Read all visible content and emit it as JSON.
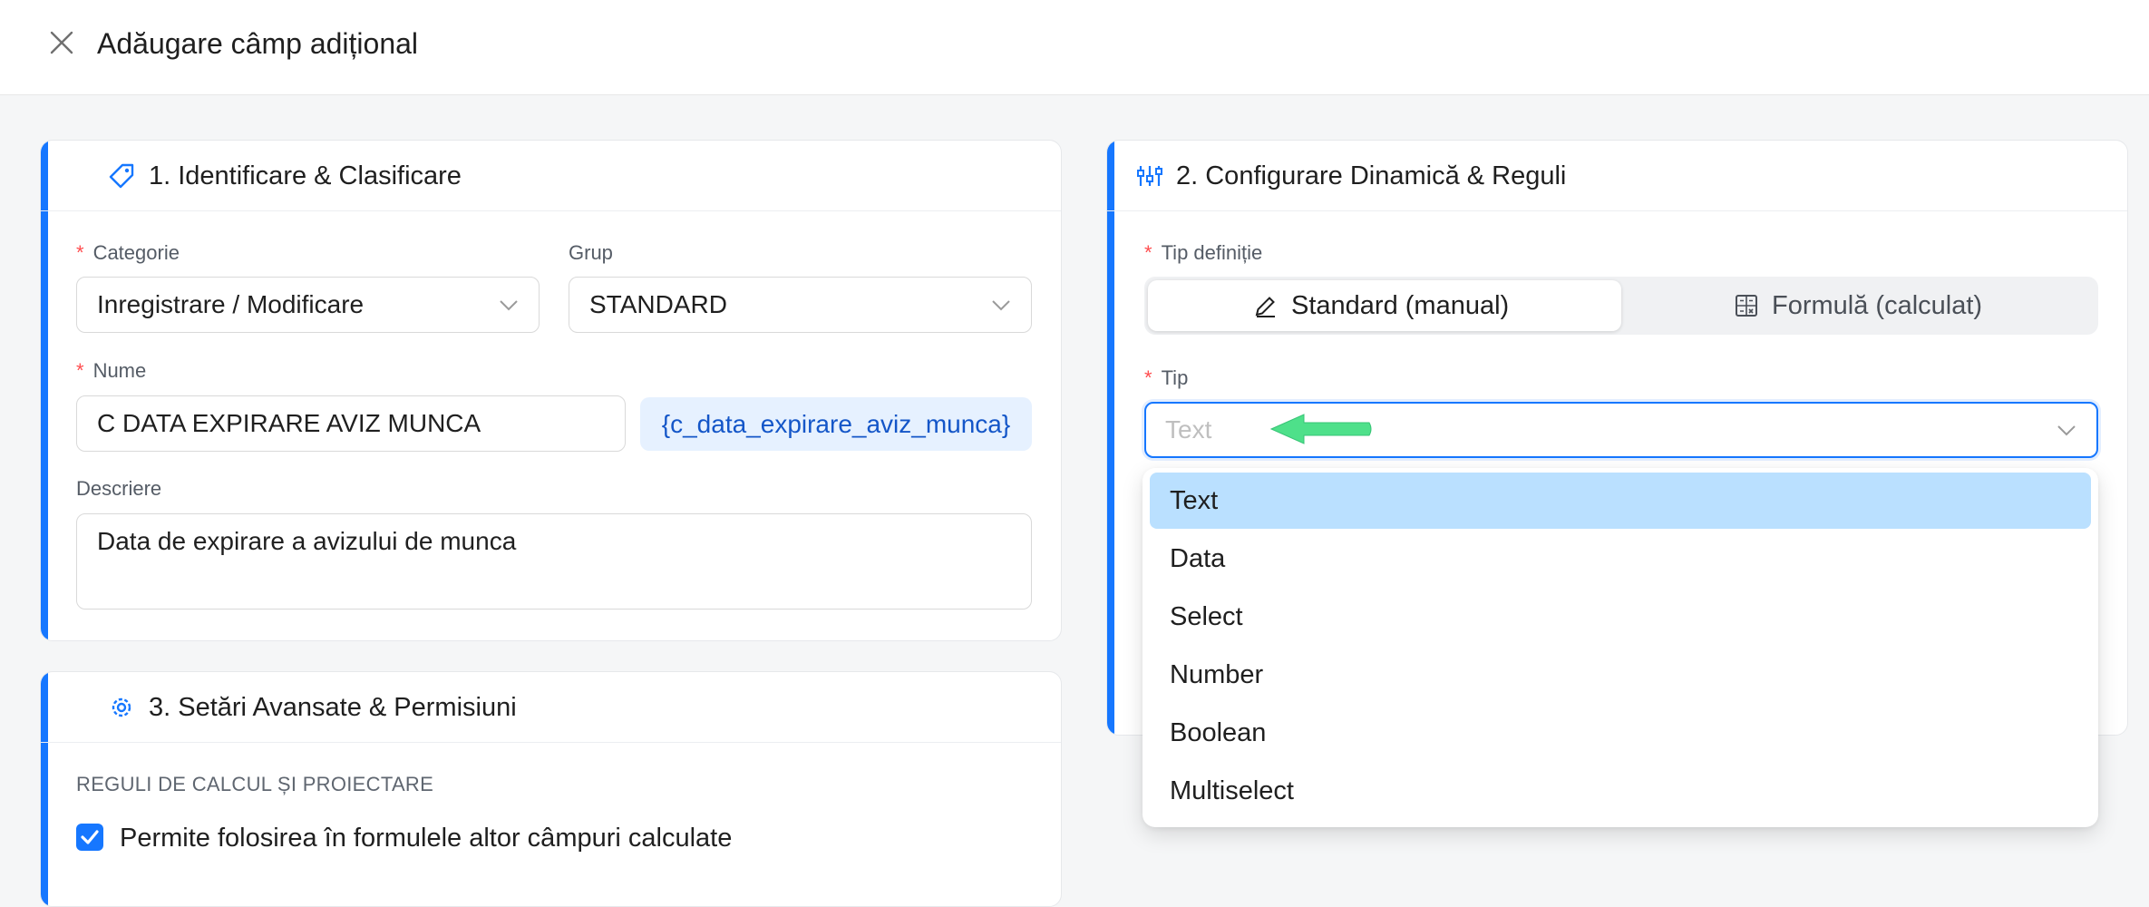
{
  "header": {
    "title": "Adăugare câmp adițional"
  },
  "section1": {
    "title": "1. Identificare & Clasificare",
    "categorie": {
      "label": "Categorie",
      "value": "Inregistrare / Modificare"
    },
    "grup": {
      "label": "Grup",
      "value": "STANDARD"
    },
    "nume": {
      "label": "Nume",
      "value": "C DATA EXPIRARE AVIZ MUNCA",
      "code": "{c_data_expirare_aviz_munca}"
    },
    "descriere": {
      "label": "Descriere",
      "value": "Data de expirare a avizului de munca"
    }
  },
  "section2": {
    "title": "2. Configurare Dinamică & Reguli",
    "tip_definitie": {
      "label": "Tip definiție",
      "options": [
        "Standard (manual)",
        "Formulă (calculat)"
      ],
      "selected": "Standard (manual)"
    },
    "tip": {
      "label": "Tip",
      "placeholder": "Text",
      "options": [
        "Text",
        "Data",
        "Select",
        "Number",
        "Boolean",
        "Multiselect"
      ],
      "highlighted": "Text"
    }
  },
  "section3": {
    "title": "3. Setări Avansate & Permisiuni",
    "subheading": "REGULI DE CALCUL ȘI PROIECTARE",
    "checkbox": {
      "label": "Permite folosirea în formulele altor câmpuri calculate",
      "checked": true
    }
  },
  "colors": {
    "accent": "#1677ff",
    "required": "#ff4d4f",
    "highlight": "#bae0ff",
    "annotation_arrow": "#4ee08a"
  },
  "icons": {
    "close": "close-icon",
    "section1": "tag-icon",
    "section2": "sliders-icon",
    "section3": "gear-icon",
    "standard": "pen-icon",
    "formula": "calculator-icon",
    "select_arrow": "chevron-down-icon"
  }
}
